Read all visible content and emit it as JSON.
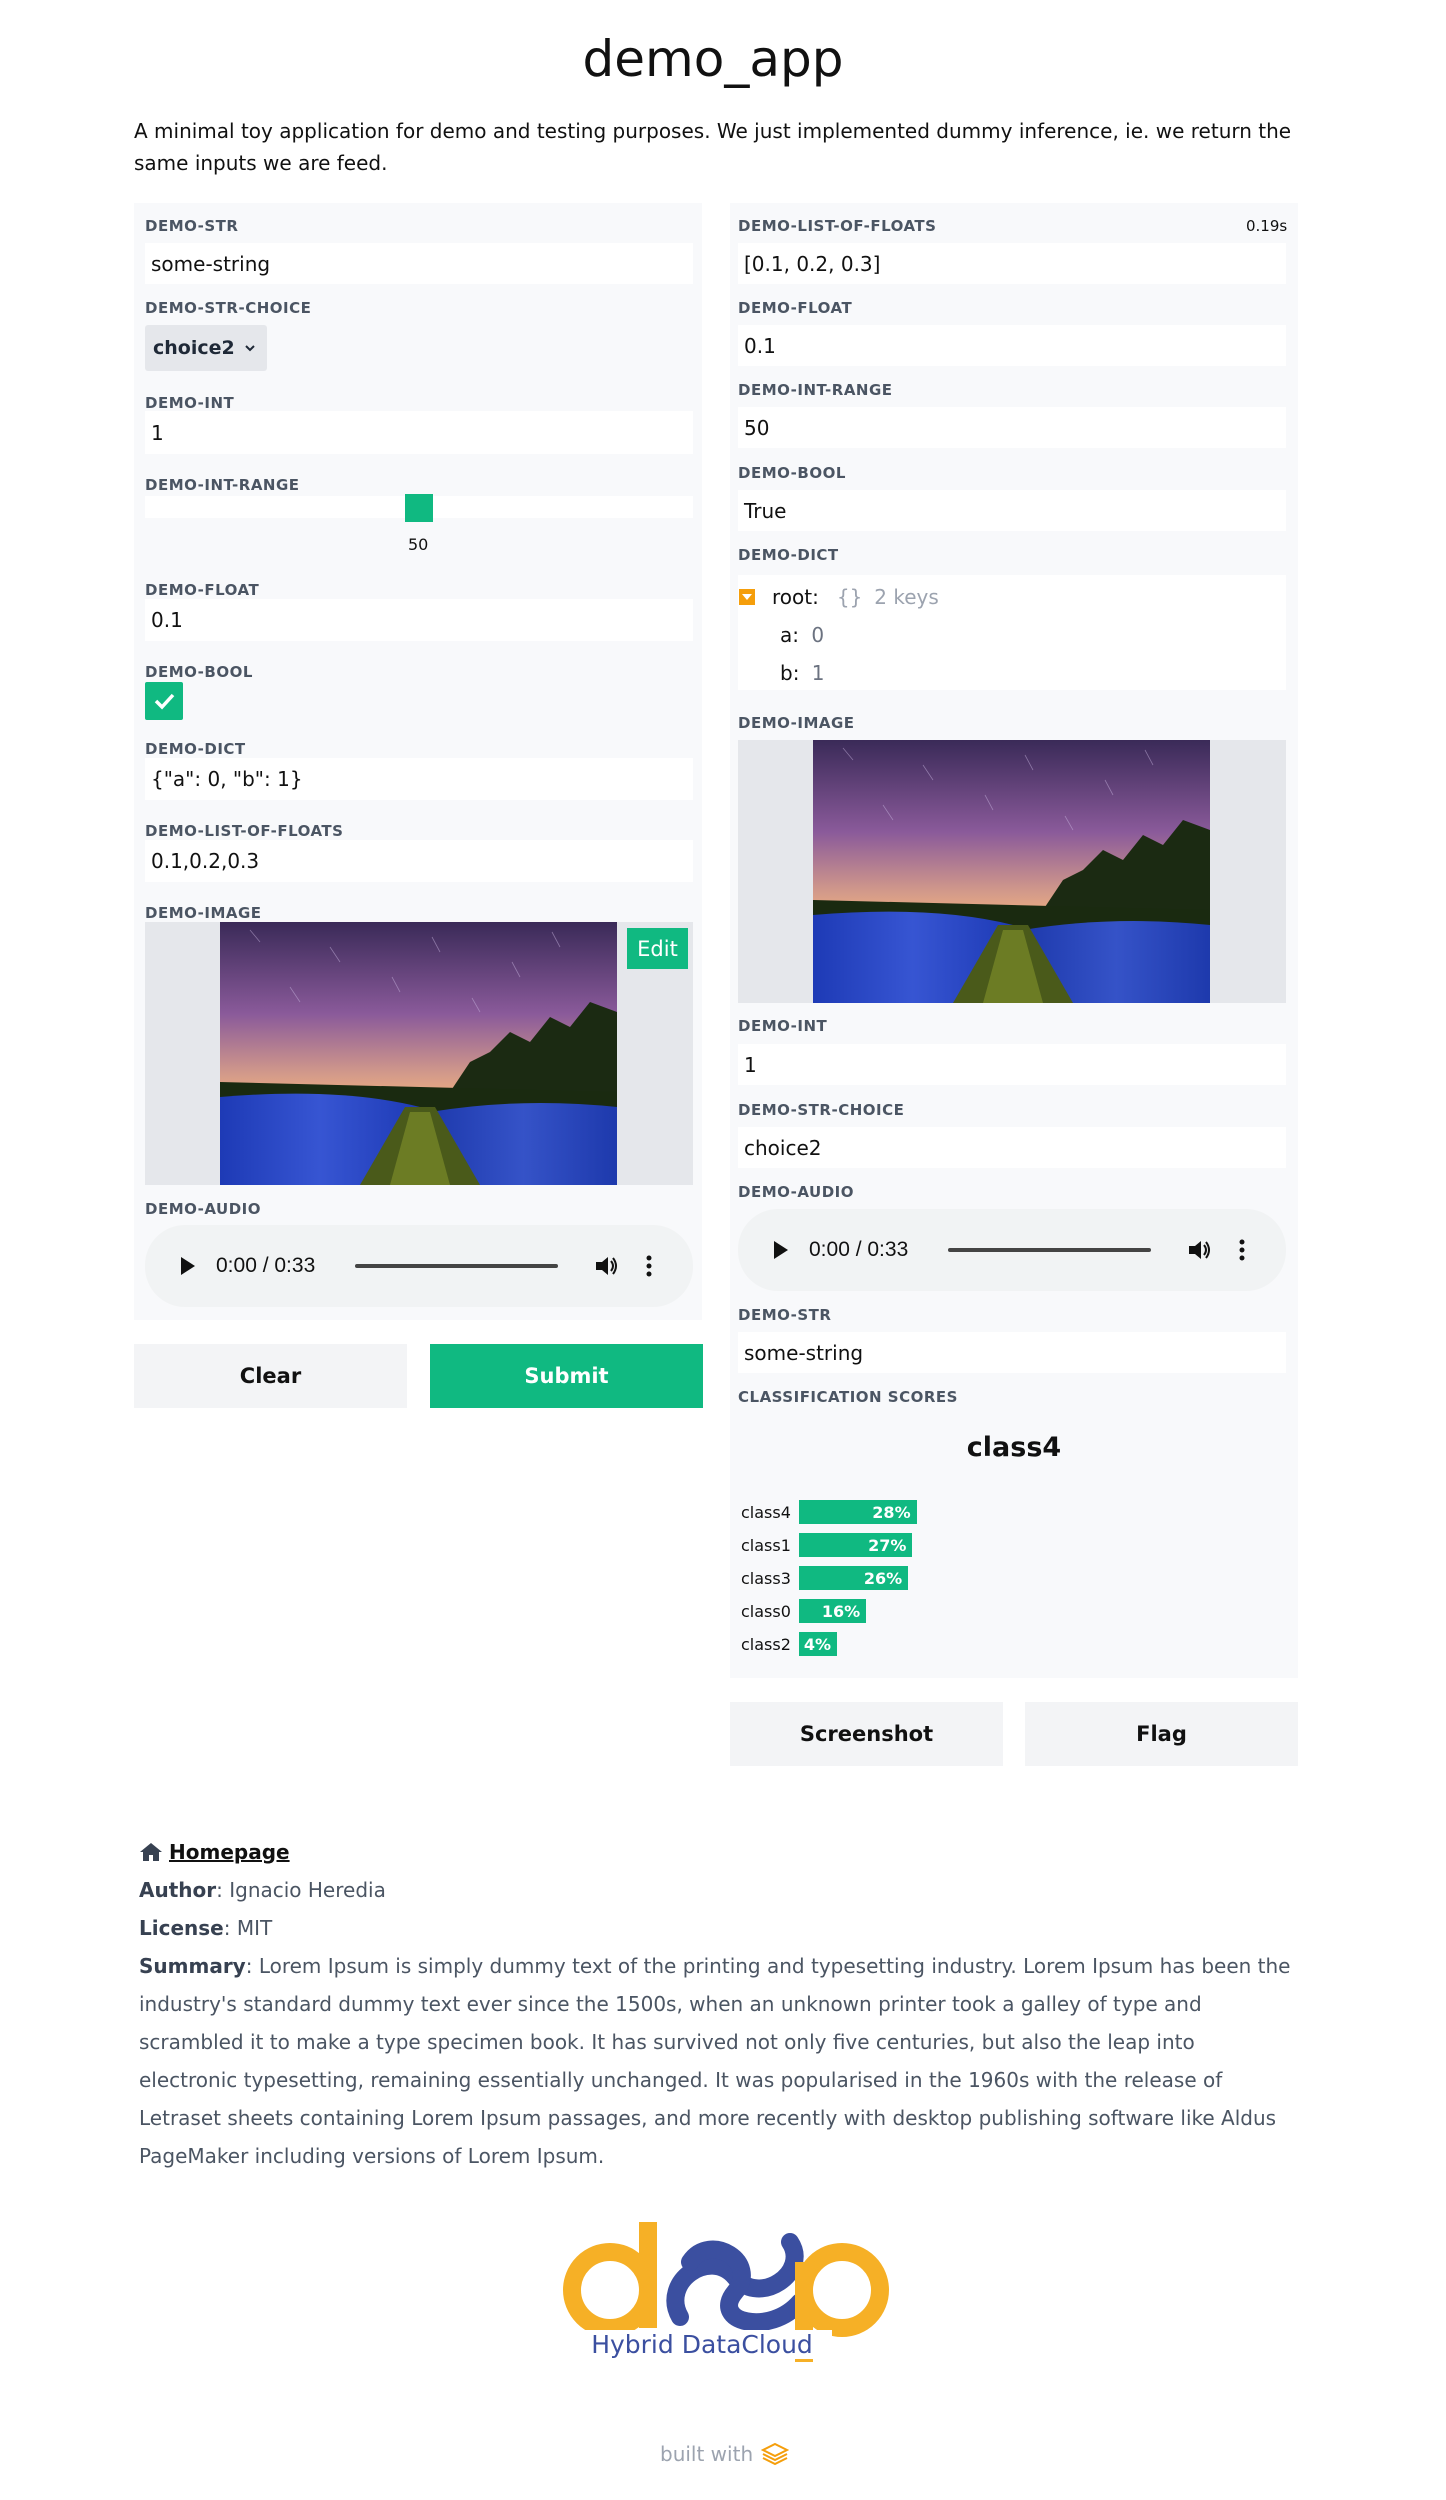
{
  "app": {
    "title": "demo_app",
    "description": "A minimal toy application for demo and testing purposes. We just implemented dummy inference, ie. we return the same inputs we are feed."
  },
  "inputs": {
    "str": {
      "label": "DEMO-STR",
      "value": "some-string"
    },
    "str_choice": {
      "label": "DEMO-STR-CHOICE",
      "value": "choice2"
    },
    "int": {
      "label": "DEMO-INT",
      "value": "1"
    },
    "int_range": {
      "label": "DEMO-INT-RANGE",
      "value": "50",
      "level": 0.5
    },
    "float": {
      "label": "DEMO-FLOAT",
      "value": "0.1"
    },
    "bool": {
      "label": "DEMO-BOOL",
      "checked": true
    },
    "dict": {
      "label": "DEMO-DICT",
      "value": "{\"a\": 0, \"b\": 1}"
    },
    "list_of_floats": {
      "label": "DEMO-LIST-OF-FLOATS",
      "value": "0.1,0.2,0.3"
    },
    "image": {
      "label": "DEMO-IMAGE",
      "edit_label": "Edit"
    },
    "audio": {
      "label": "DEMO-AUDIO",
      "time": "0:00 / 0:33"
    },
    "clear_label": "Clear",
    "submit_label": "Submit"
  },
  "outputs": {
    "elapsed": "0.19s",
    "list_of_floats": {
      "label": "DEMO-LIST-OF-FLOATS",
      "value": "[0.1, 0.2, 0.3]"
    },
    "float": {
      "label": "DEMO-FLOAT",
      "value": "0.1"
    },
    "int_range": {
      "label": "DEMO-INT-RANGE",
      "value": "50"
    },
    "bool": {
      "label": "DEMO-BOOL",
      "value": "True"
    },
    "dict": {
      "label": "DEMO-DICT",
      "root_key": "root:",
      "root_summary": "{}",
      "root_count": "2 keys",
      "a_key": "a:",
      "a_val": "0",
      "b_key": "b:",
      "b_val": "1"
    },
    "image": {
      "label": "DEMO-IMAGE"
    },
    "int": {
      "label": "DEMO-INT",
      "value": "1"
    },
    "str_choice": {
      "label": "DEMO-STR-CHOICE",
      "value": "choice2"
    },
    "audio": {
      "label": "DEMO-AUDIO",
      "time": "0:00 / 0:33"
    },
    "str": {
      "label": "DEMO-STR",
      "value": "some-string"
    },
    "classification": {
      "label": "CLASSIFICATION SCORES",
      "top_class": "class4",
      "scores": [
        {
          "name": "class4",
          "pct": "28%",
          "value": 0.28
        },
        {
          "name": "class1",
          "pct": "27%",
          "value": 0.27
        },
        {
          "name": "class3",
          "pct": "26%",
          "value": 0.26
        },
        {
          "name": "class0",
          "pct": "16%",
          "value": 0.16
        },
        {
          "name": "class2",
          "pct": "4%",
          "value": 0.04
        }
      ]
    },
    "screenshot_label": "Screenshot",
    "flag_label": "Flag"
  },
  "footer": {
    "homepage": "Homepage",
    "author_key": "Author",
    "author_val": ": Ignacio Heredia",
    "license_key": "License",
    "license_val": ": MIT",
    "summary_key": "Summary",
    "summary_val": ": Lorem Ipsum is simply dummy text of the printing and typesetting industry. Lorem Ipsum has been the industry's standard dummy text ever since the 1500s, when an unknown printer took a galley of type and scrambled it to make a type specimen book. It has survived not only five centuries, but also the leap into electronic typesetting, remaining essentially unchanged. It was popularised in the 1960s with the release of Letraset sheets containing Lorem Ipsum passages, and more recently with desktop publishing software like Aldus PageMaker including versions of Lorem Ipsum.",
    "logo_text": "deep",
    "logo_subtitle": "Hybrid DataCloud",
    "built_with": "built with"
  },
  "colors": {
    "accent": "#10b981",
    "panel": "#f8f9fb",
    "logo_orange": "#f6b026",
    "logo_blue": "#3b4fa0"
  },
  "icons": [
    "chevron-down-icon",
    "check-icon",
    "play-icon",
    "volume-icon",
    "more-vert-icon",
    "collapse-icon",
    "home-icon",
    "gradio-logo-icon"
  ]
}
